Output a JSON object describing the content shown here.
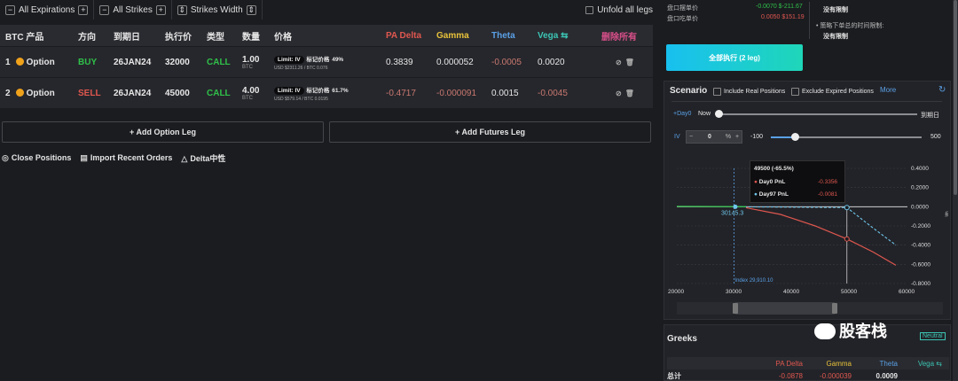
{
  "topbar": {
    "expirations": "All Expirations",
    "strikes": "All Strikes",
    "strikes_width": "Strikes Width",
    "unfold": "Unfold all legs"
  },
  "legs": {
    "headers": [
      "BTC 产品",
      "方向",
      "到期日",
      "执行价",
      "类型",
      "数量",
      "价格",
      "PA Delta",
      "Gamma",
      "Theta",
      "Vega ⇆",
      "删除所有"
    ],
    "rows": [
      {
        "idx": "1",
        "product": "Option",
        "side": "BUY",
        "expiry": "26JAN24",
        "strike": "32000",
        "type": "CALL",
        "qty": "1.00",
        "unit": "BTC",
        "limit": "Limit: IV",
        "price_label": "标记价格",
        "price_pct": "49%",
        "price_sub": "USD $2311.26 / BTC 0.076",
        "delta": "0.3839",
        "gamma": "0.000052",
        "theta": "-0.0005",
        "vega": "0.0020"
      },
      {
        "idx": "2",
        "product": "Option",
        "side": "SELL",
        "expiry": "26JAN24",
        "strike": "45000",
        "type": "CALL",
        "qty": "4.00",
        "unit": "BTC",
        "limit": "Limit: IV",
        "price_label": "标记价格",
        "price_pct": "61.7%",
        "price_sub": "USD $579.14 / BTC 0.0195",
        "delta": "-0.4717",
        "gamma": "-0.000091",
        "theta": "0.0015",
        "vega": "-0.0045"
      }
    ]
  },
  "buttons": {
    "add_option": "+ Add Option Leg",
    "add_futures": "+ Add Futures Leg"
  },
  "actions": {
    "close": "Close Positions",
    "import": "Import Recent Orders",
    "delta": "Delta中性"
  },
  "summary": {
    "row1_label": "盘口摆单价",
    "row1_value": "-0.0070 $-211.67",
    "row2_label": "盘口吃单价",
    "row2_value": "0.0050 $151.19",
    "limit1": "没有限制",
    "limit2_label": "策略下单总的时间限制:",
    "limit2": "没有限制",
    "execute": "全部执行 (2 leg)"
  },
  "scenario": {
    "title": "Scenario",
    "include_real": "Include Real Positions",
    "exclude_expired": "Exclude Expired Positions",
    "more": "More",
    "day_label": "+Day0",
    "now": "Now",
    "expiry": "到期日",
    "iv_label": "IV",
    "iv_value": "0",
    "iv_pct": "%",
    "iv_min": "-100",
    "iv_max": "500",
    "tooltip_title": "49500 (-65.5%)",
    "tooltip_day0": "Day0 PnL",
    "tooltip_day0_val": "-0.3356",
    "tooltip_day97": "Day97 PnL",
    "tooltip_day97_val": "-0.0081",
    "index_label": "Index 29,910.10",
    "breakeven": "30145.3",
    "y_axis_label": "损益",
    "x_ticks": [
      "20000",
      "30000",
      "40000",
      "50000",
      "60000"
    ],
    "y_ticks": [
      "0.4000",
      "0.2000",
      "0.0000",
      "-0.2000",
      "-0.4000",
      "-0.6000",
      "-0.8000"
    ]
  },
  "greeks": {
    "title": "Greeks",
    "neutral": "Neutral",
    "headers": [
      "PA Delta",
      "Gamma",
      "Theta",
      "Vega ⇆"
    ],
    "total_label": "总计",
    "total": [
      "-0.0878",
      "-0.000039",
      "0.0009",
      ""
    ]
  },
  "watermark": "股客栈",
  "colors": {
    "buy": "#2fc04a",
    "sell": "#e0574f",
    "call": "#2fc04a",
    "accent": "#18c0ef",
    "day0": "#e0574f",
    "day97": "#6fc6ea"
  }
}
